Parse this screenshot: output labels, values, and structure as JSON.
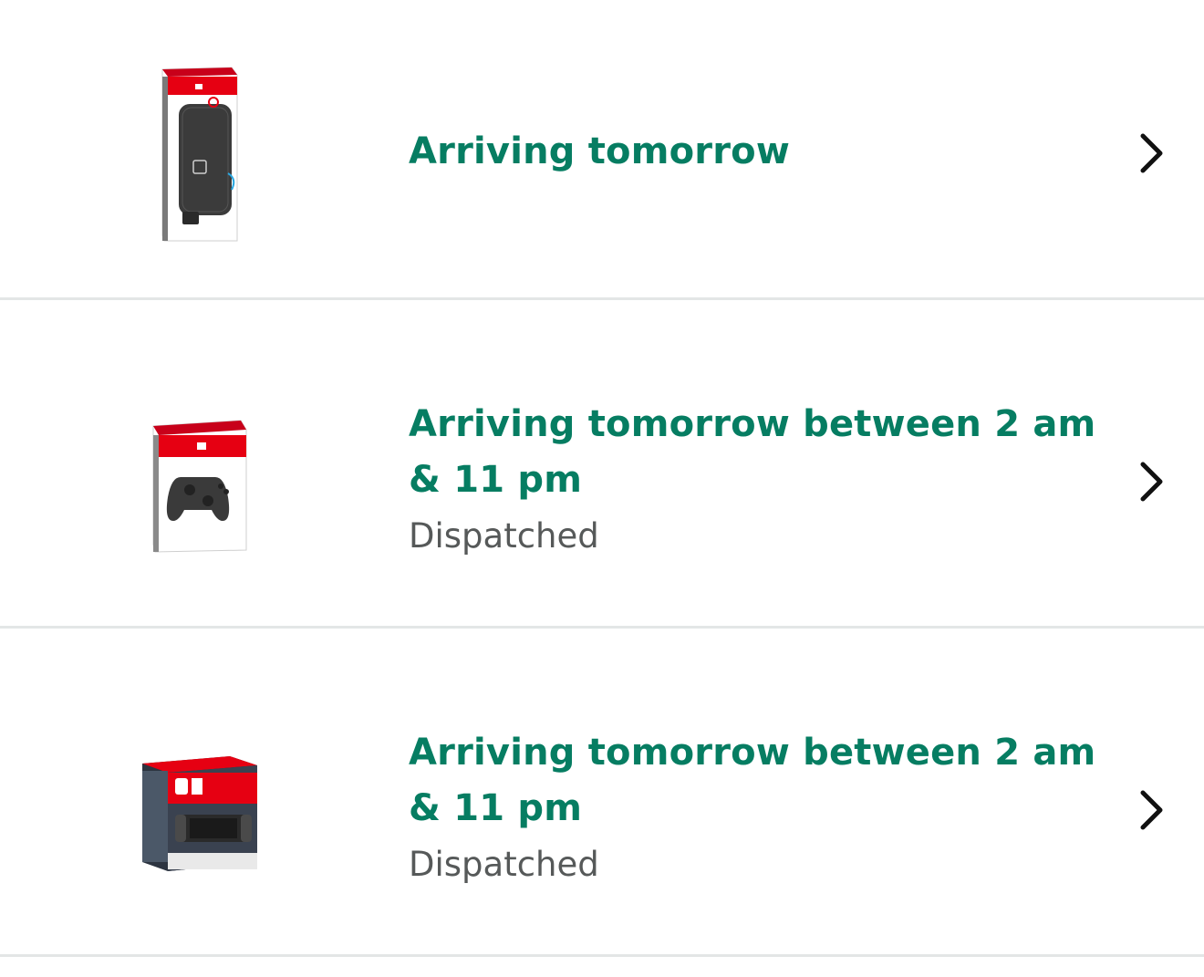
{
  "orders": [
    {
      "status_title": "Arriving tomorrow",
      "status_sub": "",
      "product_icon": "carrying-case-box-icon"
    },
    {
      "status_title": "Arriving tomorrow between 2 am & 11 pm",
      "status_sub": "Dispatched",
      "product_icon": "controller-box-icon"
    },
    {
      "status_title": "Arriving tomorrow between 2 am & 11 pm",
      "status_sub": "Dispatched",
      "product_icon": "console-box-icon"
    }
  ],
  "icons": {
    "chevron": "chevron-right-icon"
  },
  "colors": {
    "status_title": "#067d62",
    "status_sub": "#565959",
    "divider": "#e3e6e6",
    "nintendo_red": "#e60012"
  }
}
